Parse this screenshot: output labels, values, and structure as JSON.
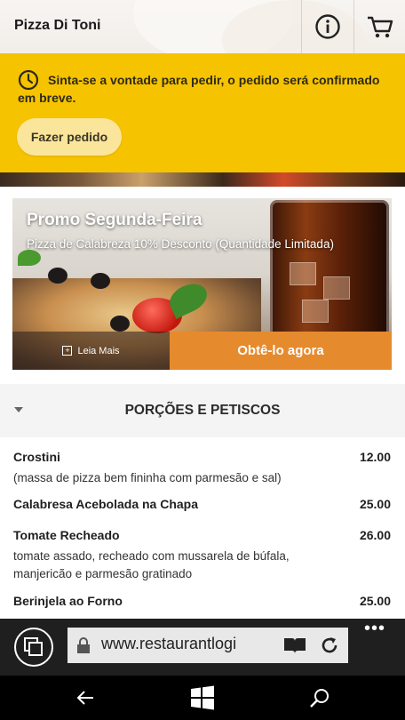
{
  "header": {
    "app_title": "Pizza Di Toni",
    "info_icon": "info-icon",
    "cart_icon": "cart-icon"
  },
  "notice": {
    "icon": "clock-icon",
    "text": "Sinta-se a vontade para pedir, o pedido será confirmado em breve.",
    "order_button": "Fazer pedido"
  },
  "promo": {
    "title": "Promo Segunda-Feira",
    "subtitle": "Pizza de Calabreza 10% Desconto (Quantidade Limitada)",
    "read_more": "Leia Mais",
    "cta": "Obtê-lo agora"
  },
  "section": {
    "title": "PORÇÕES E PETISCOS"
  },
  "menu_items": [
    {
      "name": "Crostini",
      "price": "12.00",
      "description": "(massa de pizza bem fininha com parmesão e sal)"
    },
    {
      "name": "Calabresa Acebolada na Chapa",
      "price": "25.00",
      "description": ""
    },
    {
      "name": "Tomate Recheado",
      "price": "26.00",
      "description": "tomate assado, recheado com mussarela de búfala, manjericão e parmesão gratinado"
    },
    {
      "name": "Berinjela ao Forno",
      "price": "25.00",
      "description": ""
    }
  ],
  "browser": {
    "url": "www.restaurantlogi",
    "more_label": "•••"
  },
  "colors": {
    "notice_bg": "#f6c300",
    "cta_bg": "#e68a2e"
  }
}
